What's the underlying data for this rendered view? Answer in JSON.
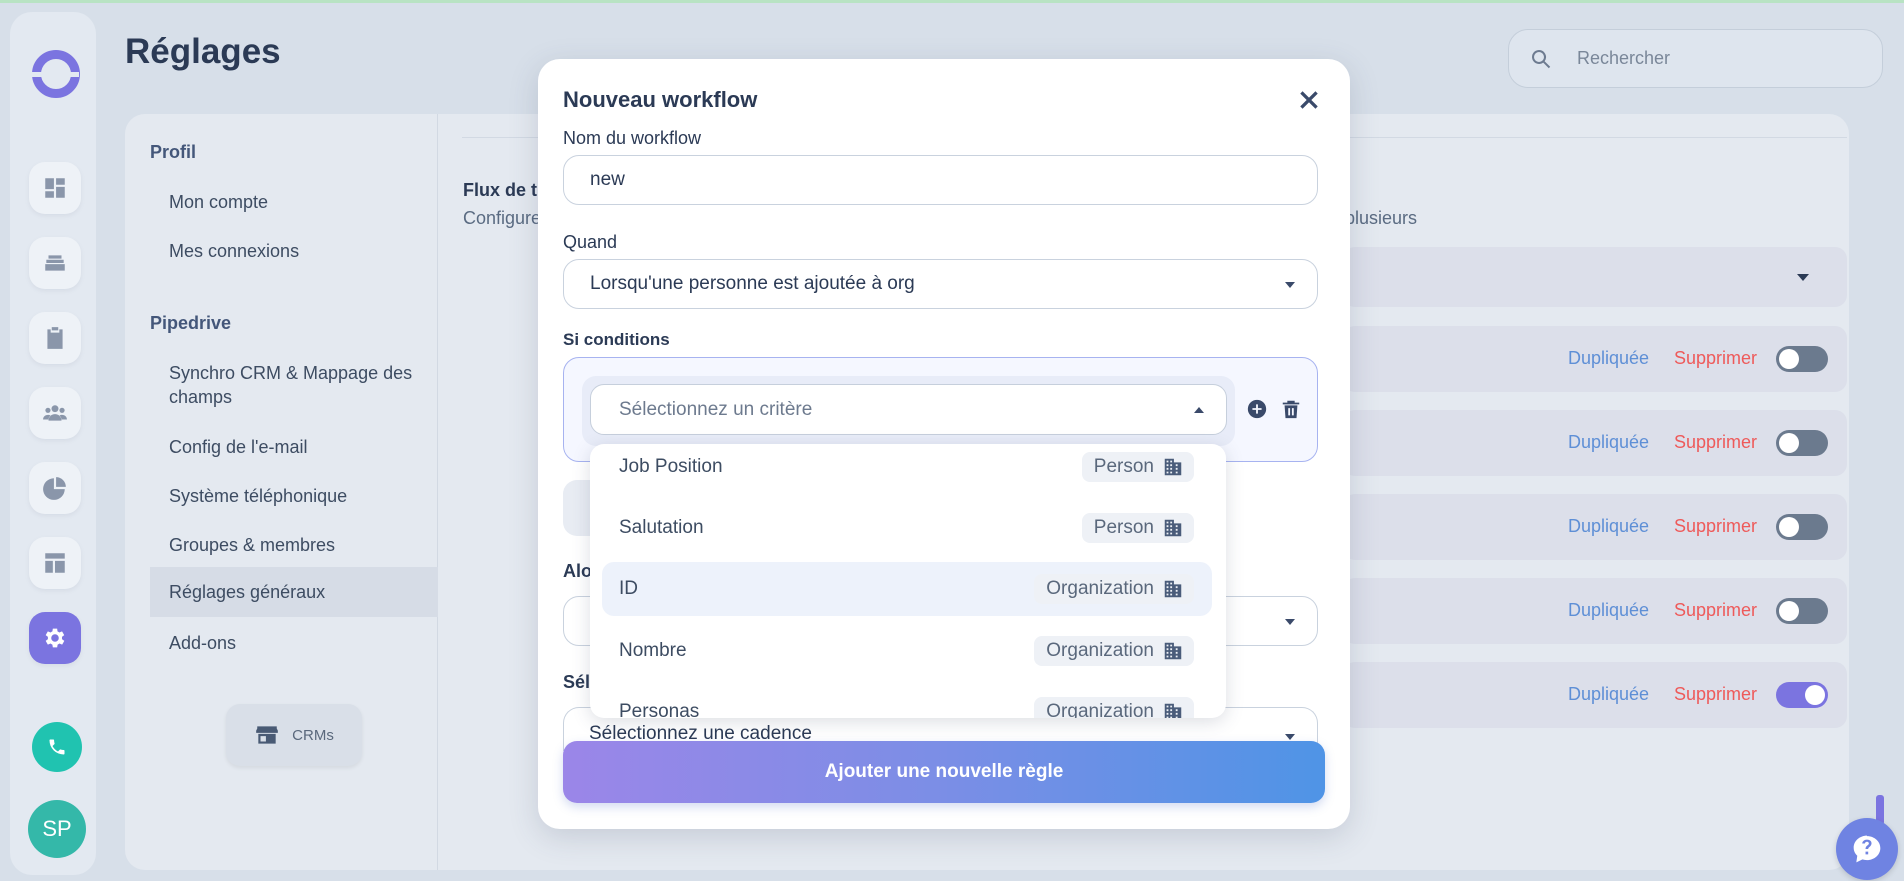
{
  "page": {
    "title": "Réglages"
  },
  "search": {
    "placeholder": "Rechercher"
  },
  "sidebar": {
    "icons": [
      "dashboard-icon",
      "inbox-icon",
      "clipboard-icon",
      "team-icon",
      "pie-chart-icon",
      "layout-icon",
      "gear-icon"
    ],
    "avatar_initials": "SP"
  },
  "settings_nav": {
    "profil_heading": "Profil",
    "profil_items": [
      "Mon compte",
      "Mes connexions"
    ],
    "pipedrive_heading": "Pipedrive",
    "pipedrive_items": [
      "Synchro CRM & Mappage des champs",
      "Config de l'e-mail",
      "Système téléphonique",
      "Groupes & membres",
      "Réglages généraux",
      "Add-ons"
    ],
    "active_item": "Réglages généraux",
    "crm_button": "CRMs"
  },
  "content": {
    "flux_title": "Flux de tr",
    "flux_desc": "Configure",
    "flux_desc_end": "plusieurs",
    "workflows": [
      {
        "dup": "Dupliquée",
        "del": "Supprimer",
        "enabled": false
      },
      {
        "dup": "Dupliquée",
        "del": "Supprimer",
        "enabled": false
      },
      {
        "dup": "Dupliquée",
        "del": "Supprimer",
        "enabled": false
      },
      {
        "dup": "Dupliquée",
        "del": "Supprimer",
        "enabled": false
      },
      {
        "dup": "Dupliquée",
        "del": "Supprimer",
        "enabled": true
      }
    ]
  },
  "modal": {
    "title": "Nouveau workflow",
    "name_label": "Nom du workflow",
    "name_value": "new",
    "when_label": "Quand",
    "when_value": "Lorsqu'une personne est ajoutée à org",
    "conditions_label": "Si conditions",
    "criterion_placeholder": "Sélectionnez un critère",
    "then_label_partial": "Alo",
    "select_label_partial": "Sél",
    "cadence_placeholder": "Sélectionnez une cadence",
    "add_rule_button": "Ajouter une nouvelle règle"
  },
  "dropdown": {
    "options": [
      {
        "label": "Job Position",
        "tag": "Person"
      },
      {
        "label": "Salutation",
        "tag": "Person"
      },
      {
        "label": "ID",
        "tag": "Organization"
      },
      {
        "label": "Nombre",
        "tag": "Organization"
      },
      {
        "label": "Personas",
        "tag": "Organization"
      }
    ],
    "highlighted": "ID"
  }
}
